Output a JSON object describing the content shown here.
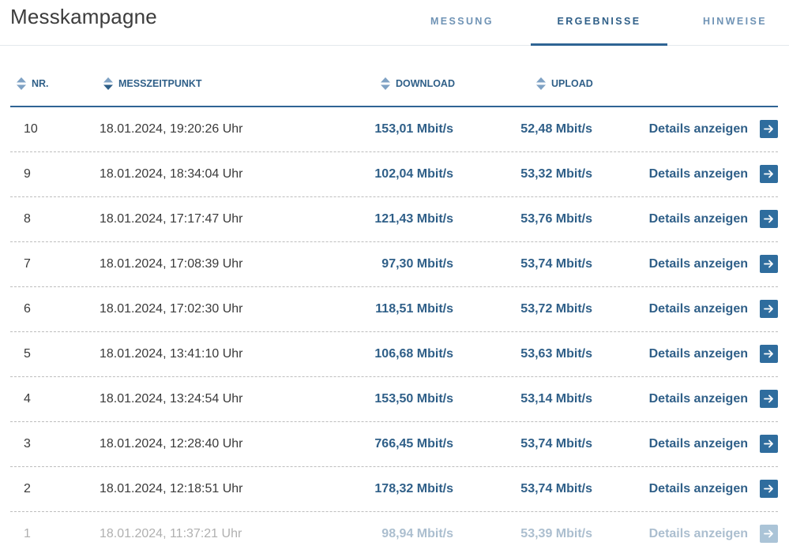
{
  "header": {
    "title": "Messkampagne",
    "tabs": [
      {
        "label": "MESSUNG",
        "active": false
      },
      {
        "label": "ERGEBNISSE",
        "active": true
      },
      {
        "label": "HINWEISE",
        "active": false
      }
    ]
  },
  "table": {
    "columns": {
      "nr": "NR.",
      "zeit": "MESSZEITPUNKT",
      "download": "DOWNLOAD",
      "upload": "UPLOAD"
    },
    "details_label": "Details anzeigen",
    "rows": [
      {
        "nr": "10",
        "zeit": "18.01.2024, 19:20:26 Uhr",
        "download": "153,01 Mbit/s",
        "upload": "52,48 Mbit/s"
      },
      {
        "nr": "9",
        "zeit": "18.01.2024, 18:34:04 Uhr",
        "download": "102,04 Mbit/s",
        "upload": "53,32 Mbit/s"
      },
      {
        "nr": "8",
        "zeit": "18.01.2024, 17:17:47 Uhr",
        "download": "121,43 Mbit/s",
        "upload": "53,76 Mbit/s"
      },
      {
        "nr": "7",
        "zeit": "18.01.2024, 17:08:39 Uhr",
        "download": "97,30 Mbit/s",
        "upload": "53,74 Mbit/s"
      },
      {
        "nr": "6",
        "zeit": "18.01.2024, 17:02:30 Uhr",
        "download": "118,51 Mbit/s",
        "upload": "53,72 Mbit/s"
      },
      {
        "nr": "5",
        "zeit": "18.01.2024, 13:41:10 Uhr",
        "download": "106,68 Mbit/s",
        "upload": "53,63 Mbit/s"
      },
      {
        "nr": "4",
        "zeit": "18.01.2024, 13:24:54 Uhr",
        "download": "153,50 Mbit/s",
        "upload": "53,14 Mbit/s"
      },
      {
        "nr": "3",
        "zeit": "18.01.2024, 12:28:40 Uhr",
        "download": "766,45 Mbit/s",
        "upload": "53,74 Mbit/s"
      },
      {
        "nr": "2",
        "zeit": "18.01.2024, 12:18:51 Uhr",
        "download": "178,32 Mbit/s",
        "upload": "53,74 Mbit/s"
      },
      {
        "nr": "1",
        "zeit": "18.01.2024, 11:37:21 Uhr",
        "download": "98,94 Mbit/s",
        "upload": "53,39 Mbit/s"
      }
    ]
  },
  "colors": {
    "accent": "#2f6494",
    "text_value": "#2f5f88",
    "tab_inactive": "#6f93b5",
    "arrow_button": "#2f6d9e"
  },
  "icons": {
    "sort": "sort-icon",
    "row_action": "arrow-right-icon"
  }
}
